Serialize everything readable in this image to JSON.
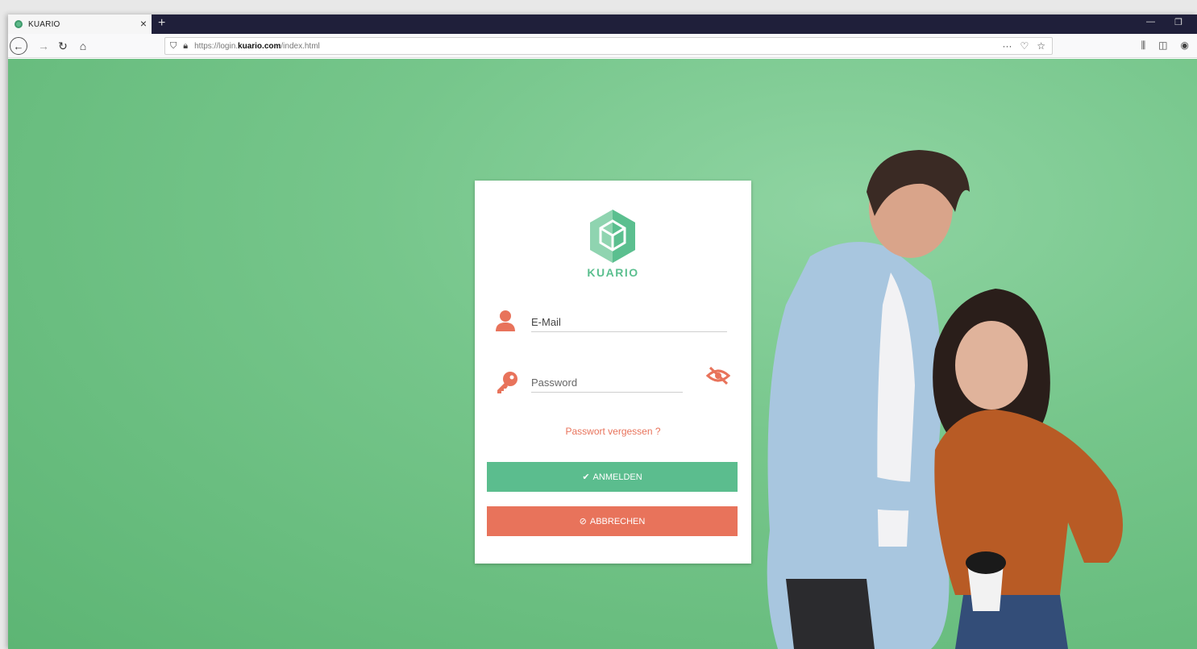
{
  "browser": {
    "tab_title": "KUARIO",
    "tab_close": "×",
    "new_tab": "+",
    "url_prefix": "https://login.",
    "url_domain": "kuario.com",
    "url_path": "/index.html",
    "url_menu": "···"
  },
  "login": {
    "brand": "KUARIO",
    "email_placeholder": "E-Mail",
    "password_placeholder": "Password",
    "forgot_link": "Passwort vergessen ?",
    "login_button": "ANMELDEN",
    "cancel_button": "ABBRECHEN"
  },
  "colors": {
    "accent_green": "#5bbd8e",
    "accent_orange": "#e8735b",
    "background_green": "#76c68b"
  }
}
